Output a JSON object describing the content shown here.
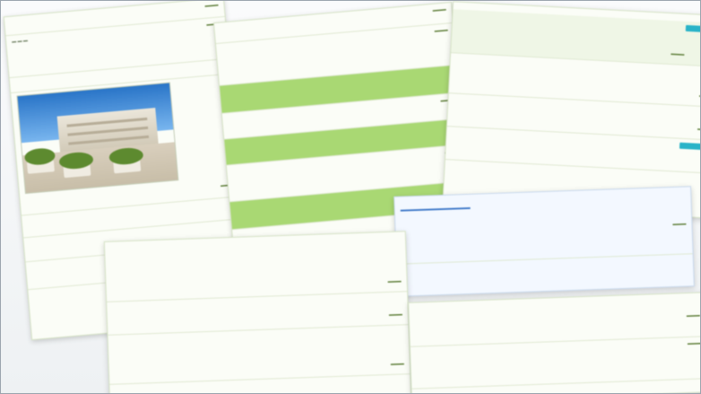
{
  "panels": {
    "left": {
      "title_row": "",
      "rows": [
        {
          "text": "",
          "meta": "",
          "right": ""
        },
        {
          "text": "",
          "meta": "",
          "right": ""
        },
        {
          "text": "",
          "meta": "",
          "right": ""
        }
      ]
    },
    "middle": {
      "rows": [
        "",
        "",
        "",
        "",
        ""
      ]
    },
    "right_top": {
      "title": "",
      "rows": [
        "",
        "",
        ""
      ]
    },
    "right_popup": {
      "title": "",
      "rows": [
        "",
        "",
        ""
      ]
    },
    "bottom": {
      "rows": [
        "",
        "",
        "",
        ""
      ]
    },
    "bottom_right": {
      "rows": [
        "",
        ""
      ]
    }
  },
  "colors": {
    "accent_green": "#a9d873",
    "accent_blue": "#29b3c8",
    "title_blue": "#2b8fc3"
  },
  "icons": {
    "photo": "building-photo"
  }
}
